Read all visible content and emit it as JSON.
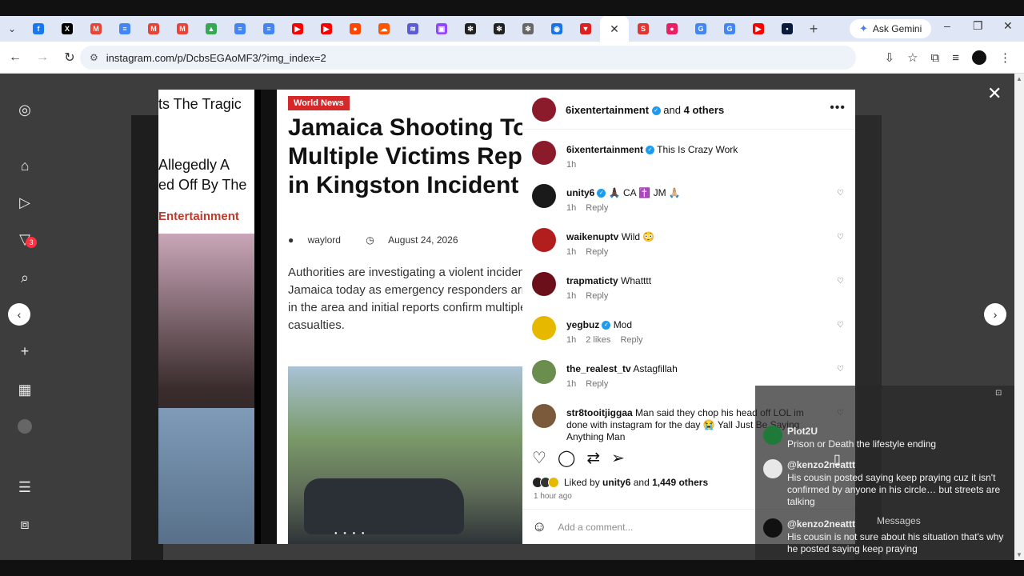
{
  "browser": {
    "tabs": [
      {
        "icon": "facebook-icon",
        "color": "#1877f2",
        "glyph": "f"
      },
      {
        "icon": "x-icon",
        "color": "#000000",
        "glyph": "X"
      },
      {
        "icon": "gmail-icon",
        "color": "#ea4335",
        "glyph": "M"
      },
      {
        "icon": "docs-icon",
        "color": "#4285f4",
        "glyph": "≡"
      },
      {
        "icon": "gmail-icon",
        "color": "#ea4335",
        "glyph": "M"
      },
      {
        "icon": "gmail-icon",
        "color": "#ea4335",
        "glyph": "M"
      },
      {
        "icon": "drive-icon",
        "color": "#34a853",
        "glyph": "▲"
      },
      {
        "icon": "docs-icon",
        "color": "#4285f4",
        "glyph": "≡"
      },
      {
        "icon": "docs-icon",
        "color": "#4285f4",
        "glyph": "≡"
      },
      {
        "icon": "youtube-icon",
        "color": "#ff0000",
        "glyph": "▶"
      },
      {
        "icon": "youtube-icon",
        "color": "#ff0000",
        "glyph": "▶"
      },
      {
        "icon": "reddit-icon",
        "color": "#ff4500",
        "glyph": "●"
      },
      {
        "icon": "soundcloud-icon",
        "color": "#ff5500",
        "glyph": "☁"
      },
      {
        "icon": "podcast-icon",
        "color": "#5b5bd6",
        "glyph": "≋"
      },
      {
        "icon": "twitch-icon",
        "color": "#9146ff",
        "glyph": "▣"
      },
      {
        "icon": "openai-icon",
        "color": "#222222",
        "glyph": "✻"
      },
      {
        "icon": "openai-icon",
        "color": "#222222",
        "glyph": "✻"
      },
      {
        "icon": "openai-icon",
        "color": "#666666",
        "glyph": "✻"
      },
      {
        "icon": "chromium-icon",
        "color": "#1a73e8",
        "glyph": "◉"
      },
      {
        "icon": "shield-icon",
        "color": "#e01e1e",
        "glyph": "▼"
      }
    ],
    "active_tab_close": "✕",
    "tabs_after": [
      {
        "icon": "s-icon",
        "color": "#e3342f",
        "glyph": "S"
      },
      {
        "icon": "record-icon",
        "color": "#e91e63",
        "glyph": "●"
      },
      {
        "icon": "google-icon",
        "color": "#4285f4",
        "glyph": "G"
      },
      {
        "icon": "google-icon",
        "color": "#4285f4",
        "glyph": "G"
      },
      {
        "icon": "youtube-icon",
        "color": "#ff0000",
        "glyph": "▶"
      },
      {
        "icon": "dark-icon",
        "color": "#0b1a3a",
        "glyph": "▪"
      }
    ],
    "new_tab": "+",
    "gemini_label": "Ask Gemini",
    "url": "instagram.com/p/DcbsEGAoMF3/?img_index=2"
  },
  "sidebar": {
    "notifications_badge": "3"
  },
  "post": {
    "prev_slide": {
      "line1": "ts The Tragic",
      "line2": "Allegedly A",
      "line3": "ed Off By The",
      "brand": "Entertainment"
    },
    "article": {
      "tag": "World News",
      "headline": "Jamaica Shooting Today: Multiple Victims Reported in Kingston Incident",
      "author": "waylord",
      "date": "August 24, 2026",
      "body": "Authorities are investigating a violent incident in Jamaica today as emergency responders arrive in the area and initial reports confirm multiple casualties."
    },
    "header": {
      "username": "6ixentertainment",
      "and_text": "and",
      "others": "4 others"
    },
    "comments": [
      {
        "user": "6ixentertainment",
        "verified": true,
        "text": "This Is Crazy Work",
        "time": "1h",
        "likes": "",
        "reply": "",
        "avatar_color": "#8b1a2b"
      },
      {
        "user": "unity6",
        "verified": true,
        "text": "🙏🏿 CA ✝️ JM 🙏🏼",
        "time": "1h",
        "likes": "",
        "reply": "Reply",
        "avatar_color": "#1a1a1a"
      },
      {
        "user": "waikenuptv",
        "verified": false,
        "text": "Wild 😳",
        "time": "1h",
        "likes": "",
        "reply": "Reply",
        "avatar_color": "#b21d1d"
      },
      {
        "user": "trapmaticty",
        "verified": false,
        "text": "Whatttt",
        "time": "1h",
        "likes": "",
        "reply": "Reply",
        "avatar_color": "#6b0f1a"
      },
      {
        "user": "yegbuz",
        "verified": true,
        "text": "Mod",
        "time": "1h",
        "likes": "2 likes",
        "reply": "Reply",
        "avatar_color": "#e6b800"
      },
      {
        "user": "the_realest_tv",
        "verified": false,
        "text": "Astagfillah",
        "time": "1h",
        "likes": "",
        "reply": "Reply",
        "avatar_color": "#6b8e4e"
      },
      {
        "user": "str8tooitjiggaa",
        "verified": false,
        "text": "Man said they chop his head off LOL im done with instagram for the day 😭 Yall Just Be Saying Anything Man",
        "time": "",
        "likes": "",
        "reply": "",
        "avatar_color": "#7a5a3a"
      }
    ],
    "liked_by": "Liked by",
    "liked_user": "unity6",
    "liked_and": "and",
    "liked_count": "1,449 others",
    "time_ago": "1 hour ago",
    "add_comment_placeholder": "Add a comment..."
  },
  "overlay": {
    "items": [
      {
        "name": "Plot2U",
        "text": "Prison or Death the lifestyle ending"
      },
      {
        "name": "@kenzo2neattt",
        "text": "His cousin posted saying keep praying cuz it isn't confirmed by anyone in his circle… but streets are talking"
      },
      {
        "name": "@kenzo2neattt",
        "text": "His cousin is not sure about his situation that's why he posted saying keep praying"
      }
    ],
    "messages_label": "Messages"
  }
}
